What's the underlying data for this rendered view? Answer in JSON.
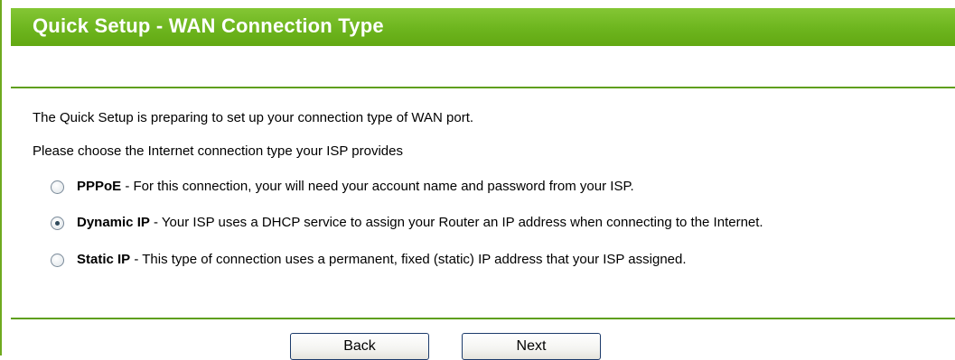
{
  "header": {
    "title": "Quick Setup - WAN Connection Type"
  },
  "content": {
    "intro_line_1": "The Quick Setup is preparing to set up your connection type of WAN port.",
    "intro_line_2": "Please choose the Internet connection type your ISP provides",
    "options": [
      {
        "name": "PPPoE",
        "description": " - For this connection, your will need your account name and password from your ISP.",
        "selected": false
      },
      {
        "name": "Dynamic IP",
        "description": " - Your ISP uses a DHCP service to assign your Router an IP address when connecting to the Internet.",
        "selected": true
      },
      {
        "name": "Static IP",
        "description": " - This type of connection uses a permanent, fixed (static) IP address that your ISP assigned.",
        "selected": false
      }
    ]
  },
  "buttons": {
    "back_label": "Back",
    "next_label": "Next"
  },
  "colors": {
    "header_green": "#6cb61d",
    "divider_green": "#5e9f1a",
    "button_border": "#1c3b6b"
  }
}
